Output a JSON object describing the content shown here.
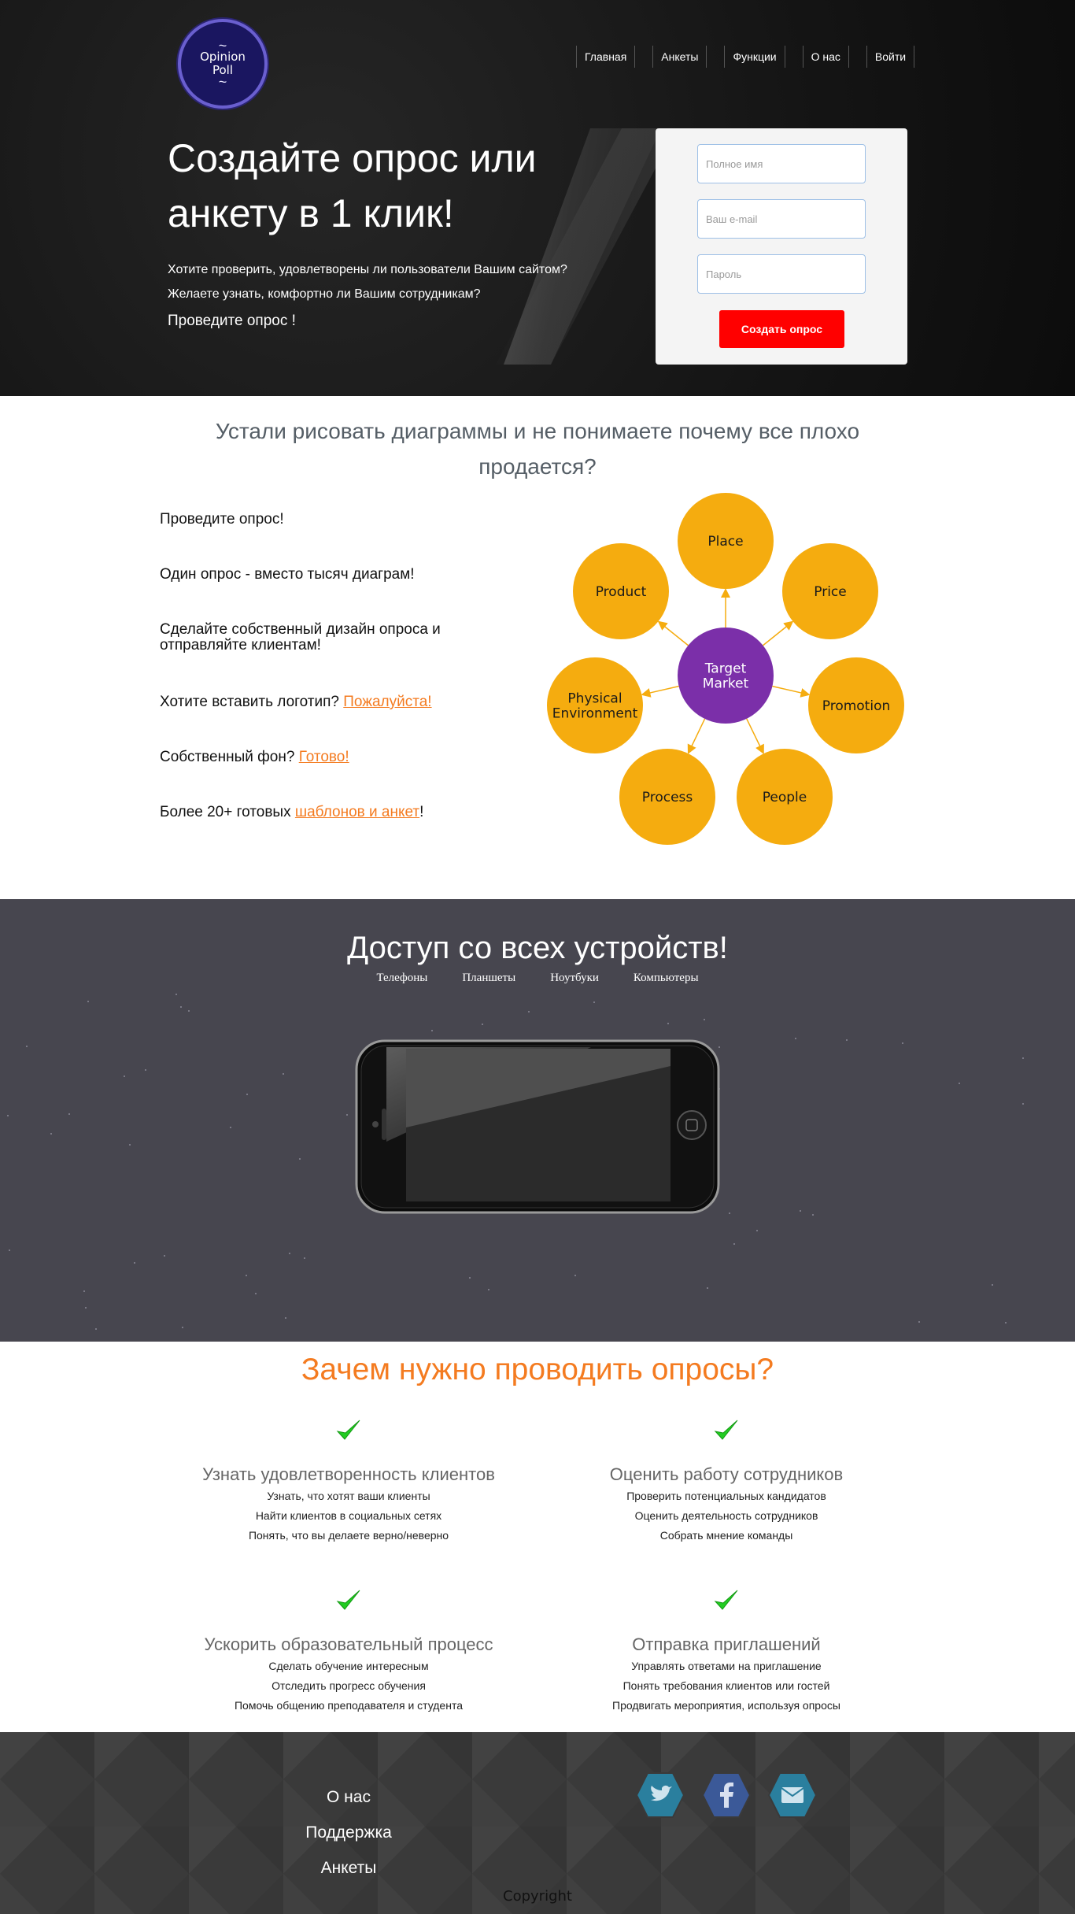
{
  "logo": {
    "line1": "Opinion",
    "line2": "Poll"
  },
  "nav": [
    "Главная",
    "Анкеты",
    "Функции",
    "О нас",
    "Войти"
  ],
  "hero": {
    "title": "Создайте опрос или анкету в 1 клик!",
    "text1": "Хотите проверить, удовлетворены ли пользователи Вашим сайтом?",
    "text2": "Желаете узнать, комфортно ли Вашим сотрудникам?",
    "cta": "Проведите опрос !"
  },
  "form": {
    "name_placeholder": "Полное имя",
    "email_placeholder": "Ваш e-mail",
    "password_placeholder": "Пароль",
    "submit": "Создать опрос"
  },
  "section2": {
    "title": "Устали рисовать диаграммы и не понимаете почему все плохо продается?",
    "items": [
      {
        "text": "Проведите опрос!",
        "link": ""
      },
      {
        "text": "Один опрос - вместо тысяч диаграм!",
        "link": ""
      },
      {
        "text": "Сделайте собственный дизайн опроса и отправляйте клиентам!",
        "link": ""
      },
      {
        "text": "Хотите вставить логотип? ",
        "link": "Пожалуйста!",
        "after": ""
      },
      {
        "text": "Собственный фон? ",
        "link": "Готово!",
        "after": ""
      },
      {
        "text": "Более 20+ готовых ",
        "link": "шаблонов и анкет",
        "after": "!"
      }
    ],
    "diagram": {
      "center": [
        "Target",
        "Market"
      ],
      "nodes": [
        [
          "Place"
        ],
        [
          "Price"
        ],
        [
          "Promotion"
        ],
        [
          "People"
        ],
        [
          "Process"
        ],
        [
          "Physical",
          "Environment"
        ],
        [
          "Product"
        ]
      ],
      "center_color": "#7b2fa9",
      "node_color": "#f5ac0f"
    }
  },
  "devices": {
    "title": "Доступ со всех устройств!",
    "tabs": [
      "Телефоны",
      "Планшеты",
      "Ноутбуки",
      "Компьютеры"
    ]
  },
  "why": {
    "title": "Зачем нужно проводить опросы?",
    "check_color": "#22cc22",
    "blocks": [
      {
        "title": "Узнать удовлетворенность клиентов",
        "lines": [
          "Узнать, что хотят ваши клиенты",
          "Найти клиентов в социальных сетях",
          "Понять, что вы делаете верно/неверно"
        ]
      },
      {
        "title": "Оценить работу сотрудников",
        "lines": [
          "Проверить потенциальных кандидатов",
          "Оценить деятельность сотрудников",
          "Собрать мнение команды"
        ]
      },
      {
        "title": "Ускорить образовательный процесс",
        "lines": [
          "Сделать обучение интересным",
          "Отследить прогресс обучения",
          "Помочь общению преподавателя и студента"
        ]
      },
      {
        "title": "Отправка приглашений",
        "lines": [
          "Управлять ответами на приглашение",
          "Понять требования клиентов или гостей",
          "Продвигать мероприятия, используя опросы"
        ]
      }
    ]
  },
  "footer": {
    "links": [
      "О нас",
      "Поддержка",
      "Анкеты"
    ],
    "social": [
      {
        "icon": "twitter-icon",
        "color": "#2a7f9e"
      },
      {
        "icon": "facebook-icon",
        "color": "#3b5998"
      },
      {
        "icon": "mail-icon",
        "color": "#2a7f9e"
      }
    ],
    "copyright": "Copyright"
  }
}
